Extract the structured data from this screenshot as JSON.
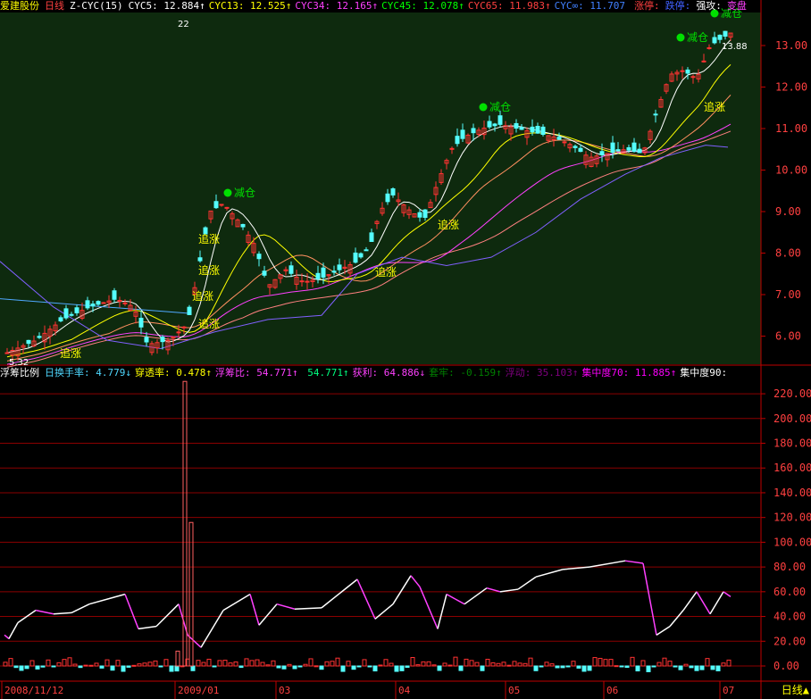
{
  "title_bar": {
    "stock_name": "爱建股份",
    "period": "日线",
    "indicator": "Z-CYC(15)",
    "values": [
      {
        "label": "CYC5:",
        "value": "12.884↑",
        "color": "#ffffff"
      },
      {
        "label": "CYC13:",
        "value": "12.525↑",
        "color": "#ffff00"
      },
      {
        "label": "CYC34:",
        "value": "12.165↑",
        "color": "#ff40ff"
      },
      {
        "label": "CYC45:",
        "value": "12.078↑",
        "color": "#00ff00"
      },
      {
        "label": "CYC65:",
        "value": "11.983↑",
        "color": "#ff4040"
      },
      {
        "label": "CYC∞:",
        "value": "11.707",
        "color": "#4080ff"
      }
    ],
    "limit_up": "涨停:",
    "limit_down": "跌停:",
    "strong": "强攻:",
    "change": "变盘"
  },
  "sub_bar": {
    "name": "浮筹比例",
    "items": [
      {
        "label": "日换手率:",
        "value": "4.779↓",
        "color": "#4fd8ff"
      },
      {
        "label": "穿透率:",
        "value": "0.478↑",
        "color": "#ffff00"
      },
      {
        "label": "浮筹比:",
        "value": "54.771↑",
        "color": "#ff40ff"
      },
      {
        "label": "",
        "value": "54.771↑",
        "color": "#00ff80"
      },
      {
        "label": "获利:",
        "value": "64.886↓",
        "color": "#ff40ff"
      },
      {
        "label": "套牢:",
        "value": "-0.159↑",
        "color": "#008000"
      },
      {
        "label": "浮动:",
        "value": "35.103↑",
        "color": "#800080"
      },
      {
        "label": "集中度70:",
        "value": "11.885↑",
        "color": "#ff00ff"
      },
      {
        "label": "集中度90:",
        "value": "",
        "color": "#ffffff"
      }
    ]
  },
  "annotations": {
    "reduce": "减仓",
    "chase": "追涨",
    "high_label": "13.88",
    "low_label": "5.32",
    "count_label": "22"
  },
  "price_axis": [
    "13.00",
    "12.00",
    "11.00",
    "10.00",
    "9.00",
    "8.00",
    "7.00",
    "6.00"
  ],
  "sub_axis": [
    "220.00",
    "200.00",
    "180.00",
    "160.00",
    "140.00",
    "120.00",
    "100.00",
    "80.00",
    "60.00",
    "40.00",
    "20.00",
    "0.00"
  ],
  "date_labels": [
    "2008/11/12",
    "2009/01",
    "03",
    "04",
    "05",
    "06",
    "07"
  ],
  "period_button": "日线",
  "colors": {
    "up": "#ff3232",
    "down": "#54ffff",
    "grid": "#8b0000",
    "bg_main": "#0e2a0e"
  }
}
